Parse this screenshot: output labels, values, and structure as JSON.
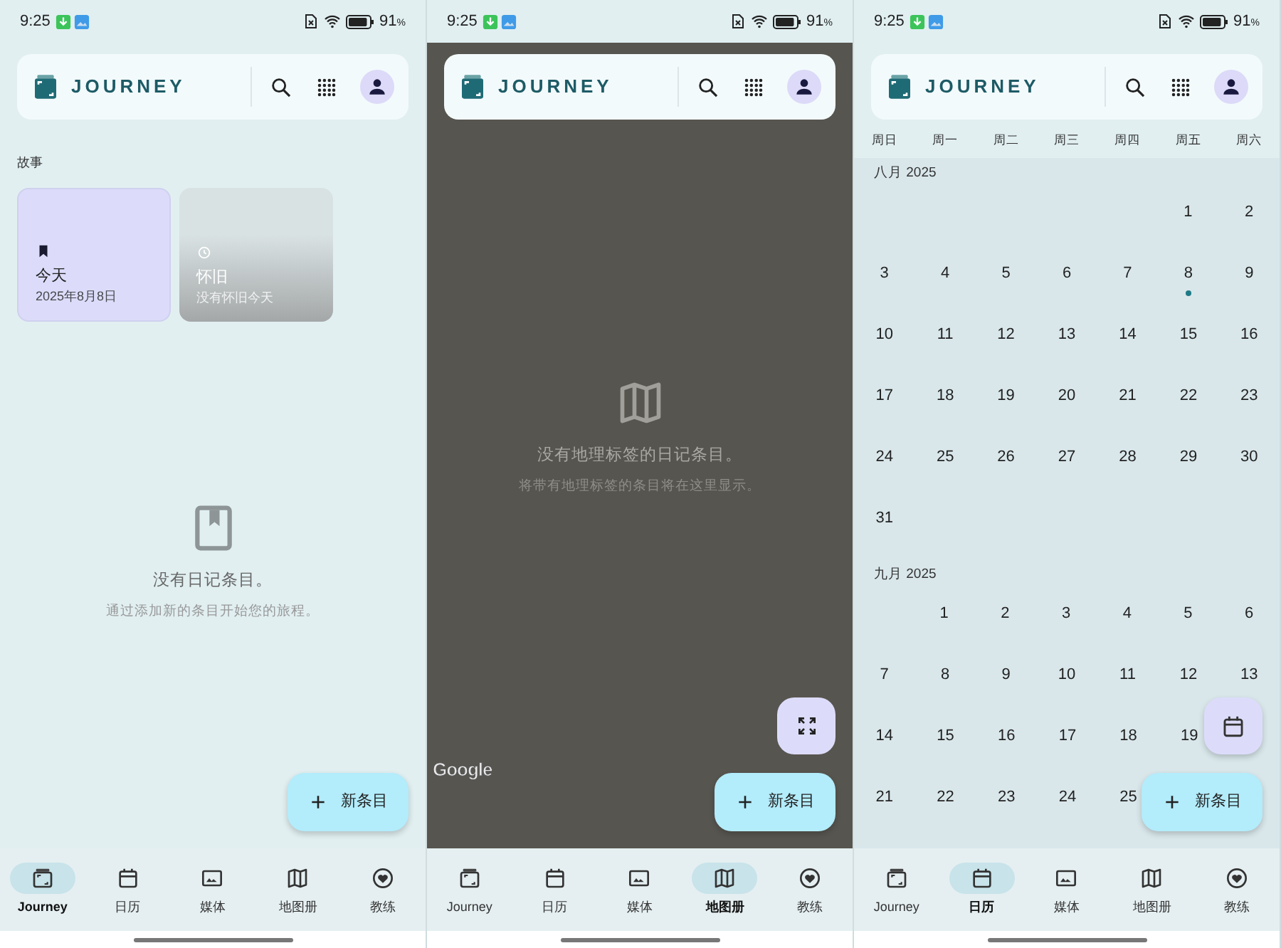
{
  "screens": [
    {
      "kind": "stories",
      "status_bar": {
        "time": "9:25",
        "battery": "91",
        "battery_unit": "%"
      },
      "header": {
        "title": "JOURNEY"
      },
      "section_title": "故事",
      "stories": [
        {
          "kind": "today",
          "title": "今天",
          "subtitle": "2025年8月8日"
        },
        {
          "kind": "nostalgia",
          "title": "怀旧",
          "subtitle": "没有怀旧今天"
        }
      ],
      "empty_state": {
        "title": "没有日记条目。",
        "text": "通过添加新的条目开始您的旅程。"
      },
      "fab": {
        "label": "新条目"
      },
      "nav": [
        {
          "label": "Journey",
          "selected": true
        },
        {
          "label": "日历",
          "selected": false
        },
        {
          "label": "媒体",
          "selected": false
        },
        {
          "label": "地图册",
          "selected": false
        },
        {
          "label": "教练",
          "selected": false
        }
      ]
    },
    {
      "kind": "map",
      "status_bar": {
        "time": "9:25",
        "battery": "91",
        "battery_unit": "%"
      },
      "header": {
        "title": "JOURNEY"
      },
      "empty_state": {
        "title": "没有地理标签的日记条目。",
        "text": "将带有地理标签的条目将在这里显示。"
      },
      "map_logo": "Google",
      "fab": {
        "label": "新条目"
      },
      "nav": [
        {
          "label": "Journey",
          "selected": false
        },
        {
          "label": "日历",
          "selected": false
        },
        {
          "label": "媒体",
          "selected": false
        },
        {
          "label": "地图册",
          "selected": true
        },
        {
          "label": "教练",
          "selected": false
        }
      ]
    },
    {
      "kind": "calendar",
      "status_bar": {
        "time": "9:25",
        "battery": "91",
        "battery_unit": "%"
      },
      "header": {
        "title": "JOURNEY"
      },
      "weekdays": [
        "周日",
        "周一",
        "周二",
        "周三",
        "周四",
        "周五",
        "周六"
      ],
      "months": [
        {
          "label": "八月 2025",
          "weeks": [
            {
              "days": [
                {
                  "n": "1",
                  "event": false
                },
                {
                  "n": "2",
                  "event": false
                }
              ]
            },
            {
              "days": [
                {
                  "n": "3",
                  "event": false
                },
                {
                  "n": "4",
                  "event": false
                },
                {
                  "n": "5",
                  "event": false
                },
                {
                  "n": "6",
                  "event": false
                },
                {
                  "n": "7",
                  "event": false
                },
                {
                  "n": "8",
                  "event": true
                },
                {
                  "n": "9",
                  "event": false
                }
              ]
            },
            {
              "days": [
                {
                  "n": "10",
                  "event": false
                },
                {
                  "n": "11",
                  "event": false
                },
                {
                  "n": "12",
                  "event": false
                },
                {
                  "n": "13",
                  "event": false
                },
                {
                  "n": "14",
                  "event": false
                },
                {
                  "n": "15",
                  "event": false
                },
                {
                  "n": "16",
                  "event": false
                }
              ]
            },
            {
              "days": [
                {
                  "n": "17",
                  "event": false
                },
                {
                  "n": "18",
                  "event": false
                },
                {
                  "n": "19",
                  "event": false
                },
                {
                  "n": "20",
                  "event": false
                },
                {
                  "n": "21",
                  "event": false
                },
                {
                  "n": "22",
                  "event": false
                },
                {
                  "n": "23",
                  "event": false
                }
              ]
            },
            {
              "days": [
                {
                  "n": "24",
                  "event": false
                },
                {
                  "n": "25",
                  "event": false
                },
                {
                  "n": "26",
                  "event": false
                },
                {
                  "n": "27",
                  "event": false
                },
                {
                  "n": "28",
                  "event": false
                },
                {
                  "n": "29",
                  "event": false
                },
                {
                  "n": "30",
                  "event": false
                }
              ]
            },
            {
              "days": [
                {
                  "n": "31",
                  "event": false
                }
              ]
            }
          ]
        },
        {
          "label": "九月 2025",
          "weeks": [
            {
              "days": [
                {
                  "n": "1",
                  "event": false
                },
                {
                  "n": "2",
                  "event": false
                },
                {
                  "n": "3",
                  "event": false
                },
                {
                  "n": "4",
                  "event": false
                },
                {
                  "n": "5",
                  "event": false
                },
                {
                  "n": "6",
                  "event": false
                }
              ]
            },
            {
              "days": [
                {
                  "n": "7",
                  "event": false
                },
                {
                  "n": "8",
                  "event": false
                },
                {
                  "n": "9",
                  "event": false
                },
                {
                  "n": "10",
                  "event": false
                },
                {
                  "n": "11",
                  "event": false
                },
                {
                  "n": "12",
                  "event": false
                },
                {
                  "n": "13",
                  "event": false
                }
              ]
            },
            {
              "days": [
                {
                  "n": "14",
                  "event": false
                },
                {
                  "n": "15",
                  "event": false
                },
                {
                  "n": "16",
                  "event": false
                },
                {
                  "n": "17",
                  "event": false
                },
                {
                  "n": "18",
                  "event": false
                },
                {
                  "n": "19",
                  "event": false
                }
              ]
            },
            {
              "days": [
                {
                  "n": "21",
                  "event": false
                },
                {
                  "n": "22",
                  "event": false
                },
                {
                  "n": "23",
                  "event": false
                },
                {
                  "n": "24",
                  "event": false
                },
                {
                  "n": "25",
                  "event": false
                }
              ]
            }
          ]
        }
      ],
      "fab": {
        "label": "新条目"
      },
      "nav": [
        {
          "label": "Journey",
          "selected": false
        },
        {
          "label": "日历",
          "selected": true
        },
        {
          "label": "媒体",
          "selected": false
        },
        {
          "label": "地图册",
          "selected": false
        },
        {
          "label": "教练",
          "selected": false
        }
      ]
    }
  ]
}
